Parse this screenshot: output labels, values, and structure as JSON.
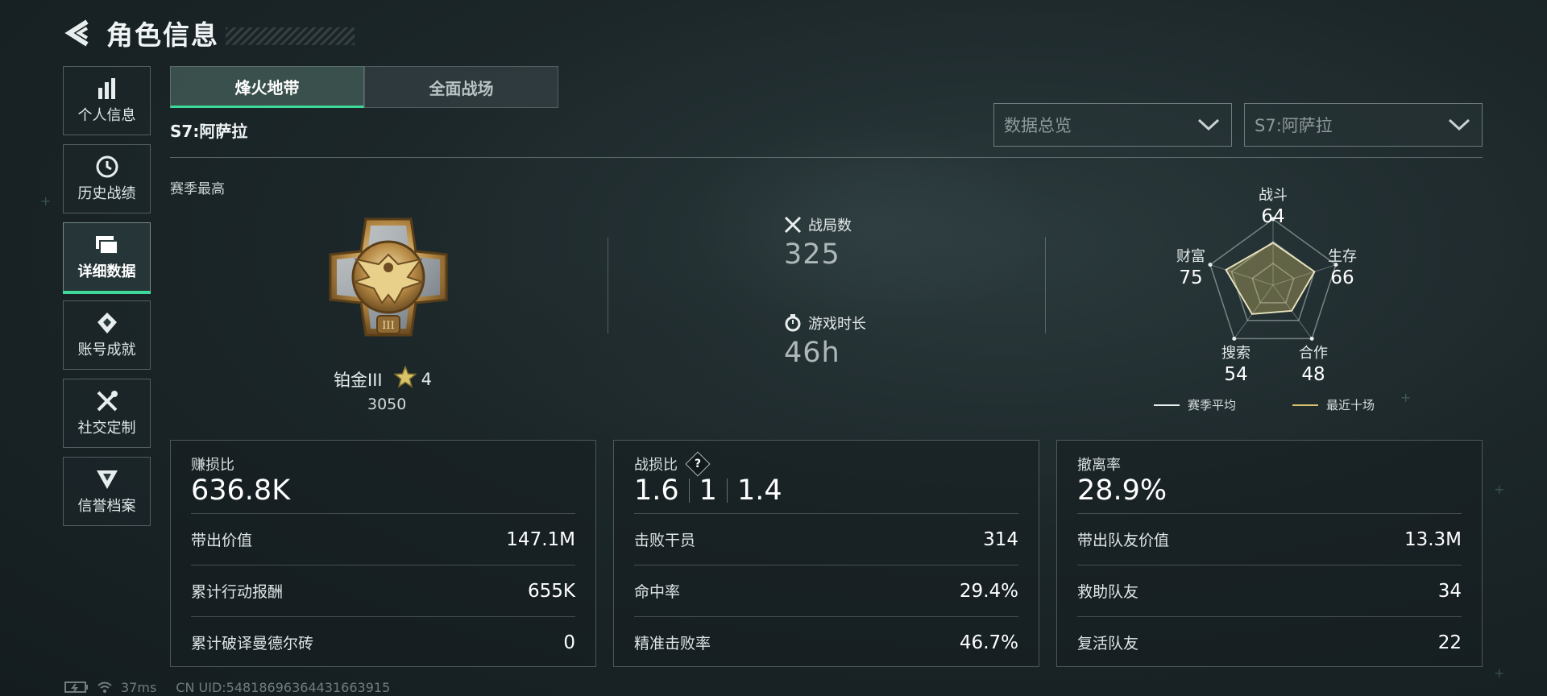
{
  "header": {
    "title": "角色信息"
  },
  "sidebar": {
    "items": [
      {
        "label": "个人信息",
        "icon": "bar-chart-icon"
      },
      {
        "label": "历史战绩",
        "icon": "clock-icon"
      },
      {
        "label": "详细数据",
        "icon": "folders-icon",
        "active": true
      },
      {
        "label": "账号成就",
        "icon": "achievement-icon"
      },
      {
        "label": "社交定制",
        "icon": "tools-icon"
      },
      {
        "label": "信誉档案",
        "icon": "shield-icon"
      }
    ]
  },
  "tabs": [
    {
      "label": "烽火地带",
      "active": true
    },
    {
      "label": "全面战场",
      "active": false
    }
  ],
  "season": {
    "label": "S7:阿萨拉"
  },
  "filters": {
    "overview": "数据总览",
    "season": "S7:阿萨拉"
  },
  "summary": {
    "season_best_label": "赛季最高",
    "rank_name": "铂金III",
    "rank_stars": "4",
    "rank_score": "3050",
    "matches_label": "战局数",
    "matches_value": "325",
    "playtime_label": "游戏时长",
    "playtime_value": "46h"
  },
  "radar": {
    "axes": [
      {
        "label": "战斗",
        "value": "64"
      },
      {
        "label": "生存",
        "value": "66"
      },
      {
        "label": "合作",
        "value": "48"
      },
      {
        "label": "搜索",
        "value": "54"
      },
      {
        "label": "财富",
        "value": "75"
      }
    ],
    "legend": [
      {
        "label": "赛季平均",
        "color": "#e8eeee"
      },
      {
        "label": "最近十场",
        "color": "#d8c36a"
      }
    ]
  },
  "cards": [
    {
      "title": "赚损比",
      "main": "636.8K",
      "rows": [
        {
          "label": "带出价值",
          "value": "147.1M"
        },
        {
          "label": "累计行动报酬",
          "value": "655K"
        },
        {
          "label": "累计破译曼德尔砖",
          "value": "0"
        }
      ]
    },
    {
      "title": "战损比",
      "help": "?",
      "kd": [
        "1.6",
        "1",
        "1.4"
      ],
      "rows": [
        {
          "label": "击败干员",
          "value": "314"
        },
        {
          "label": "命中率",
          "value": "29.4%"
        },
        {
          "label": "精准击败率",
          "value": "46.7%"
        }
      ]
    },
    {
      "title": "撤离率",
      "main": "28.9%",
      "rows": [
        {
          "label": "带出队友价值",
          "value": "13.3M"
        },
        {
          "label": "救助队友",
          "value": "34"
        },
        {
          "label": "复活队友",
          "value": "22"
        }
      ]
    }
  ],
  "footer": {
    "ping": "37ms",
    "uid": "CN UID:54818696364431663915"
  },
  "colors": {
    "accent": "#3fd79a",
    "gold": "#d8c36a"
  }
}
